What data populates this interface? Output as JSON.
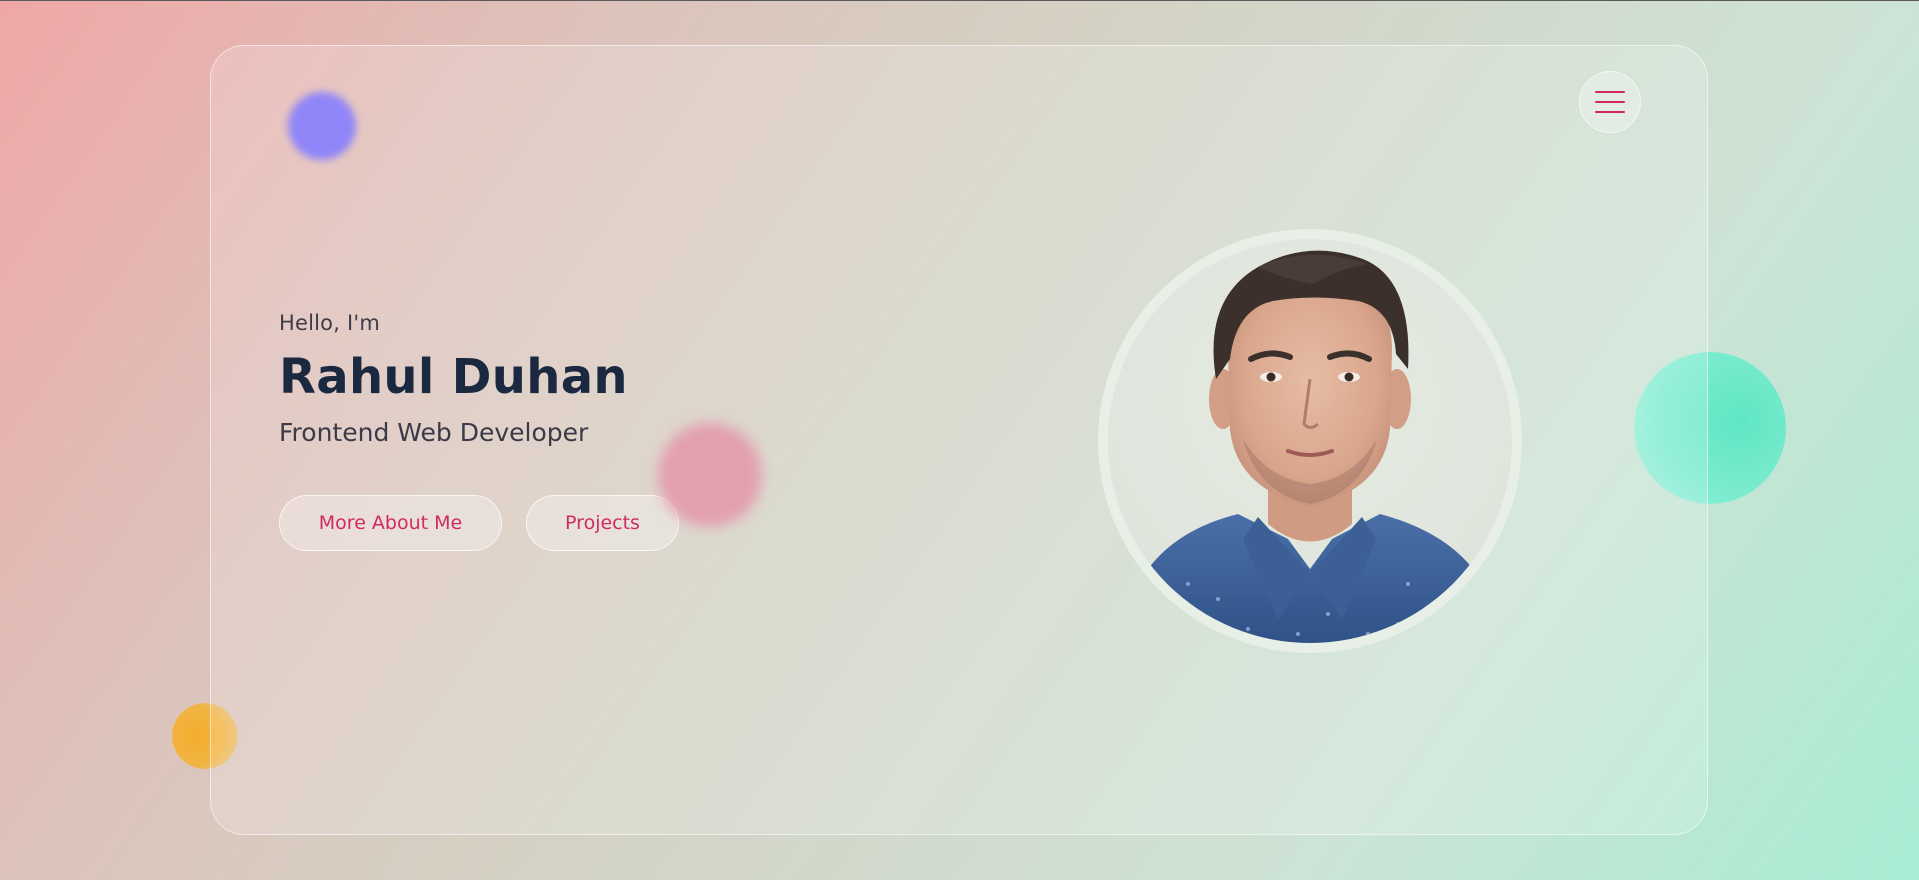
{
  "hero": {
    "greeting": "Hello, I'm",
    "name": "Rahul Duhan",
    "role": "Frontend Web Developer"
  },
  "buttons": {
    "about_label": "More About Me",
    "projects_label": "Projects"
  },
  "menu": {
    "icon": "hamburger-menu-icon"
  },
  "avatar": {
    "icon": "profile-photo"
  },
  "colors": {
    "accent": "#d1275f",
    "name": "#1b2940",
    "blob_blue": "#6c63ff",
    "blob_pink": "#e58ea6",
    "blob_green": "#5fe6c4",
    "blob_yellow": "#f3ad2d"
  }
}
